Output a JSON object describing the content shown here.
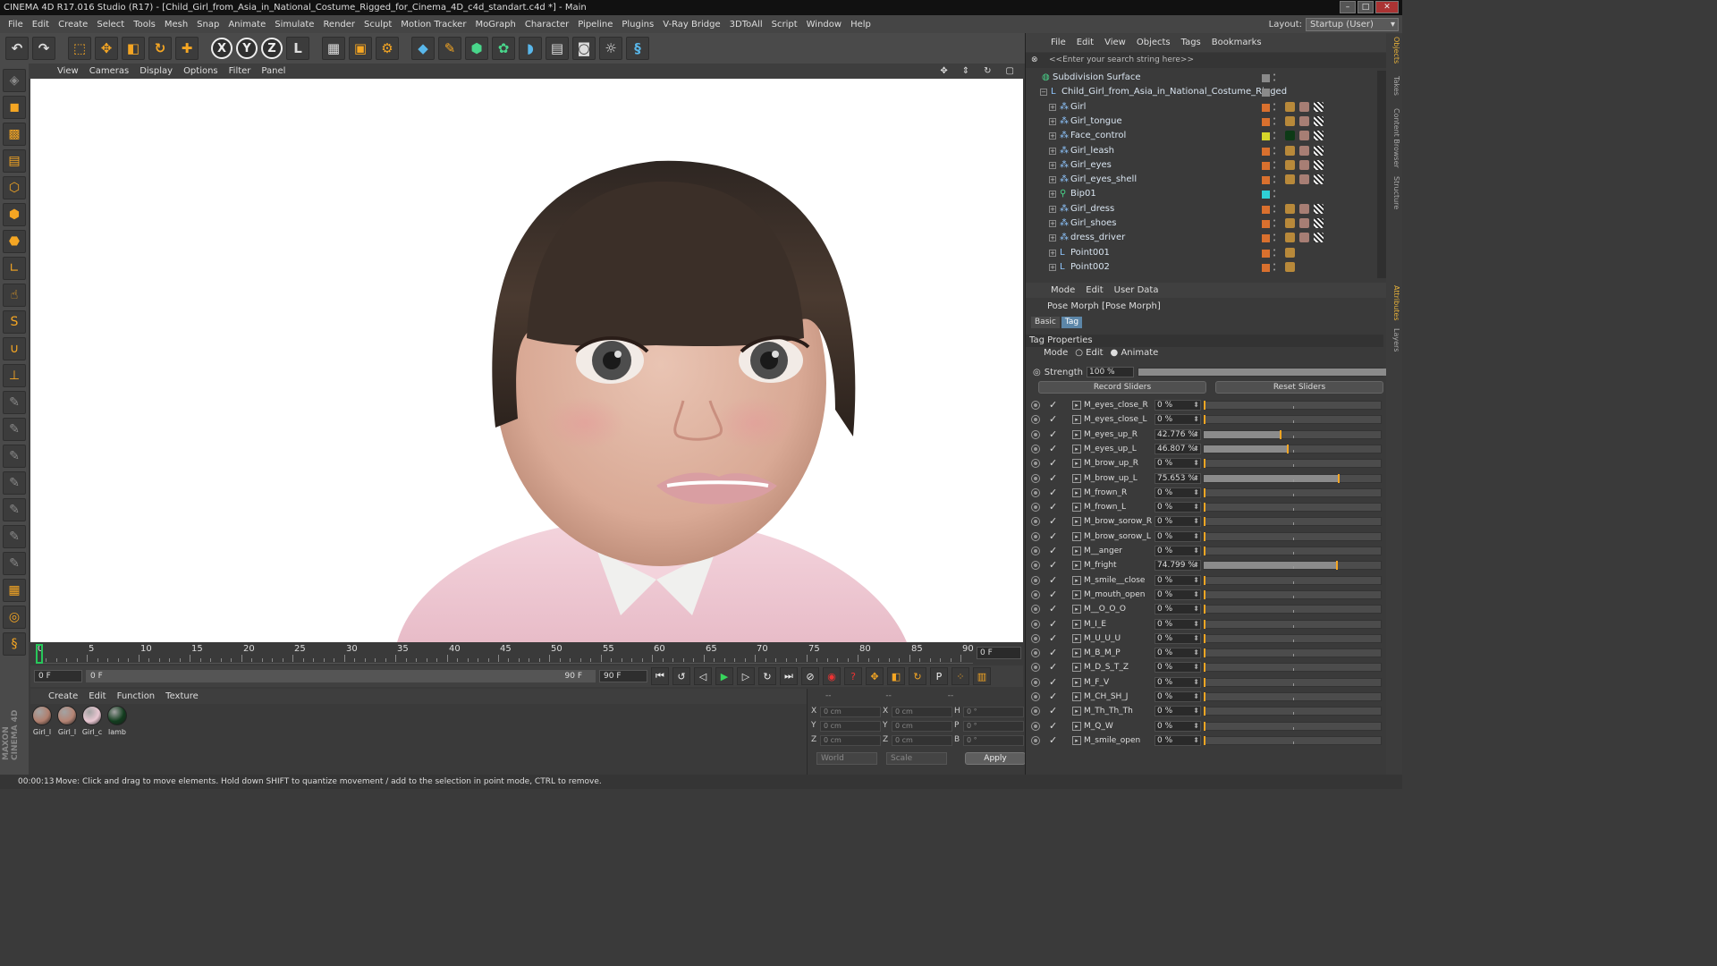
{
  "window": {
    "title": "CINEMA 4D R17.016 Studio (R17) - [Child_Girl_from_Asia_in_National_Costume_Rigged_for_Cinema_4D_c4d_standart.c4d *] - Main"
  },
  "menubar": [
    "File",
    "Edit",
    "Create",
    "Select",
    "Tools",
    "Mesh",
    "Snap",
    "Animate",
    "Simulate",
    "Render",
    "Sculpt",
    "Motion Tracker",
    "MoGraph",
    "Character",
    "Pipeline",
    "Plugins",
    "V-Ray Bridge",
    "3DToAll",
    "Script",
    "Window",
    "Help"
  ],
  "layout": {
    "label": "Layout:",
    "value": "Startup (User)"
  },
  "viewport": {
    "menu": [
      "View",
      "Cameras",
      "Display",
      "Options",
      "Filter",
      "Panel"
    ]
  },
  "timeline": {
    "labels": [
      "0",
      "5",
      "10",
      "15",
      "20",
      "25",
      "30",
      "35",
      "40",
      "45",
      "50",
      "55",
      "60",
      "65",
      "70",
      "75",
      "80",
      "85",
      "90"
    ],
    "current_frame": "0 F"
  },
  "playbar": {
    "start": "0 F",
    "range_start": "0 F",
    "range_end": "90 F",
    "end": "90 F"
  },
  "materials": {
    "menu": [
      "Create",
      "Edit",
      "Function",
      "Texture"
    ],
    "items": [
      {
        "name": "Girl_l",
        "color": "#b07f6e"
      },
      {
        "name": "Girl_l",
        "color": "#b58474"
      },
      {
        "name": "Girl_c",
        "color": "#e9c7d2"
      },
      {
        "name": "lamb",
        "color": "#123d1e"
      }
    ]
  },
  "coordinates": {
    "headers": [
      "--",
      "--",
      "--"
    ],
    "rows": [
      {
        "a": "X",
        "av": "0 cm",
        "b": "X",
        "bv": "0 cm",
        "c": "H",
        "cv": "0 °"
      },
      {
        "a": "Y",
        "av": "0 cm",
        "b": "Y",
        "bv": "0 cm",
        "c": "P",
        "cv": "0 °"
      },
      {
        "a": "Z",
        "av": "0 cm",
        "b": "Z",
        "bv": "0 cm",
        "c": "B",
        "cv": "0 °"
      }
    ],
    "world": "World",
    "scale": "Scale",
    "apply": "Apply"
  },
  "status": {
    "time": "00:00:13",
    "message": "Move: Click and drag to move elements. Hold down SHIFT to quantize movement / add to the selection in point mode, CTRL to remove."
  },
  "objects": {
    "menu": [
      "File",
      "Edit",
      "View",
      "Objects",
      "Tags",
      "Bookmarks"
    ],
    "search_placeholder": "<<Enter your search string here>>",
    "items": [
      {
        "name": "Subdivision Surface",
        "color": "#8a8a8a"
      },
      {
        "name": "Child_Girl_from_Asia_in_National_Costume_Rigged",
        "color": "#8a8a8a"
      },
      {
        "name": "Girl",
        "color": "#d9702e"
      },
      {
        "name": "Girl_tongue",
        "color": "#d9702e"
      },
      {
        "name": "Face_control",
        "color": "#d6d62a"
      },
      {
        "name": "Girl_leash",
        "color": "#d9702e"
      },
      {
        "name": "Girl_eyes",
        "color": "#d9702e"
      },
      {
        "name": "Girl_eyes_shell",
        "color": "#d9702e"
      },
      {
        "name": "Bip01",
        "color": "#2fd0d6"
      },
      {
        "name": "Girl_dress",
        "color": "#d9702e"
      },
      {
        "name": "Girl_shoes",
        "color": "#d9702e"
      },
      {
        "name": "dress_driver",
        "color": "#d9702e"
      },
      {
        "name": "Point001",
        "color": "#d9702e"
      },
      {
        "name": "Point002",
        "color": "#d9702e"
      }
    ]
  },
  "right_tabs": [
    "Objects",
    "Takes",
    "Content Browser",
    "Structure",
    "Attributes",
    "Layers"
  ],
  "attributes": {
    "menu": [
      "Mode",
      "Edit",
      "User Data"
    ],
    "title": "Pose Morph [Pose Morph]",
    "tabs": [
      "Basic",
      "Tag"
    ],
    "section": "Tag Properties",
    "mode_label": "Mode",
    "mode_edit": "Edit",
    "mode_animate": "Animate",
    "strength_label": "Strength",
    "strength_value": "100 %",
    "strength_level": 1.0,
    "record": "Record Sliders",
    "reset": "Reset Sliders",
    "sliders": [
      {
        "name": "M_eyes_close_R",
        "value": "0 %",
        "level": 0
      },
      {
        "name": "M_eyes_close_L",
        "value": "0 %",
        "level": 0
      },
      {
        "name": "M_eyes_up_R",
        "value": "42.776 %",
        "level": 0.42776
      },
      {
        "name": "M_eyes_up_L",
        "value": "46.807 %",
        "level": 0.46807
      },
      {
        "name": "M_brow_up_R",
        "value": "0 %",
        "level": 0
      },
      {
        "name": "M_brow_up_L",
        "value": "75.653 %",
        "level": 0.75653
      },
      {
        "name": "M_frown_R",
        "value": "0 %",
        "level": 0
      },
      {
        "name": "M_frown_L",
        "value": "0 %",
        "level": 0
      },
      {
        "name": "M_brow_sorow_R",
        "value": "0 %",
        "level": 0
      },
      {
        "name": "M_brow_sorow_L",
        "value": "0 %",
        "level": 0
      },
      {
        "name": "M__anger",
        "value": "0 %",
        "level": 0
      },
      {
        "name": "M_fright",
        "value": "74.799 %",
        "level": 0.74799
      },
      {
        "name": "M_smile__close",
        "value": "0 %",
        "level": 0
      },
      {
        "name": "M_mouth_open",
        "value": "0 %",
        "level": 0
      },
      {
        "name": "M__O_O_O",
        "value": "0 %",
        "level": 0
      },
      {
        "name": "M_I_E",
        "value": "0 %",
        "level": 0
      },
      {
        "name": "M_U_U_U",
        "value": "0 %",
        "level": 0
      },
      {
        "name": "M_B_M_P",
        "value": "0 %",
        "level": 0
      },
      {
        "name": "M_D_S_T_Z",
        "value": "0 %",
        "level": 0
      },
      {
        "name": "M_F_V",
        "value": "0 %",
        "level": 0
      },
      {
        "name": "M_CH_SH_J",
        "value": "0 %",
        "level": 0
      },
      {
        "name": "M_Th_Th_Th",
        "value": "0 %",
        "level": 0
      },
      {
        "name": "M_Q_W",
        "value": "0 %",
        "level": 0
      },
      {
        "name": "M_smile_open",
        "value": "0 %",
        "level": 0
      }
    ]
  }
}
